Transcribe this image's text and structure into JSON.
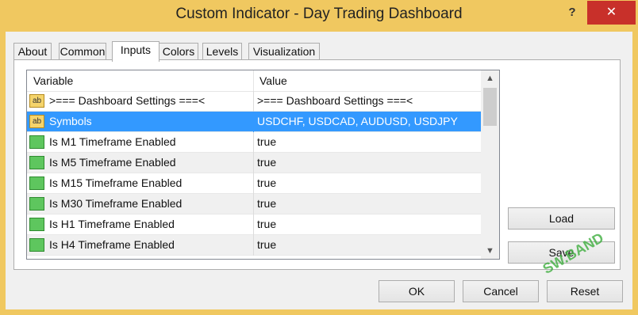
{
  "window": {
    "title": "Custom Indicator - Day Trading Dashboard",
    "help_label": "?",
    "close_label": "✕"
  },
  "tabs": [
    {
      "label": "About"
    },
    {
      "label": "Common"
    },
    {
      "label": "Inputs",
      "active": true
    },
    {
      "label": "Colors"
    },
    {
      "label": "Levels"
    },
    {
      "label": "Visualization"
    }
  ],
  "grid": {
    "col_variable": "Variable",
    "col_value": "Value",
    "rows": [
      {
        "icon": "ab",
        "variable": ">=== Dashboard Settings ===<",
        "value": ">=== Dashboard Settings ===<"
      },
      {
        "icon": "ab",
        "variable": "Symbols",
        "value": "USDCHF, USDCAD, AUDUSD, USDJPY",
        "selected": true
      },
      {
        "icon": "bool",
        "variable": "Is M1 Timeframe Enabled",
        "value": "true"
      },
      {
        "icon": "bool",
        "variable": "Is M5 Timeframe Enabled",
        "value": "true"
      },
      {
        "icon": "bool",
        "variable": "Is M15 Timeframe Enabled",
        "value": "true"
      },
      {
        "icon": "bool",
        "variable": "Is M30 Timeframe Enabled",
        "value": "true"
      },
      {
        "icon": "bool",
        "variable": "Is H1 Timeframe Enabled",
        "value": "true"
      },
      {
        "icon": "bool",
        "variable": "Is H4 Timeframe Enabled",
        "value": "true"
      }
    ]
  },
  "buttons": {
    "load": "Load",
    "save": "Save",
    "ok": "OK",
    "cancel": "Cancel",
    "reset": "Reset"
  },
  "watermark": "SW.BAND",
  "colors": {
    "title_bar": "#f0c860",
    "close": "#c8302a",
    "selection": "#3399ff"
  }
}
